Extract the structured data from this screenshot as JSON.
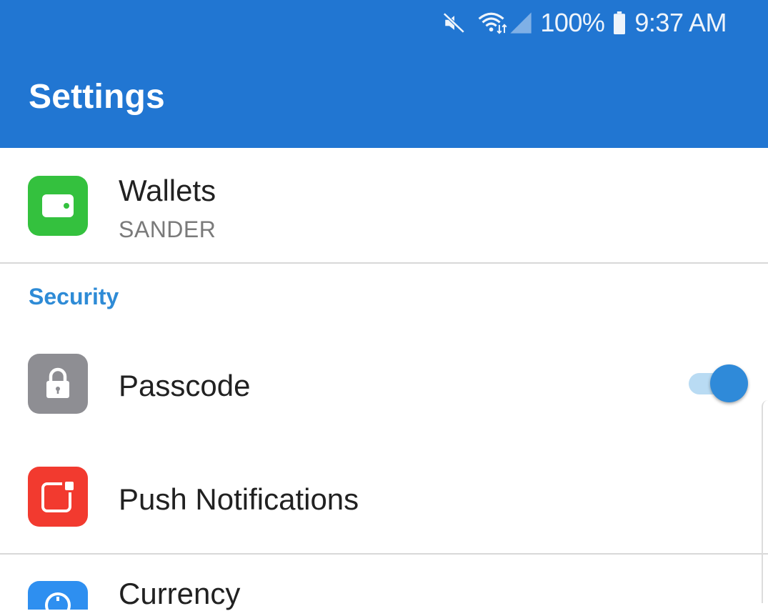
{
  "status_bar": {
    "battery_percent": "100%",
    "time": "9:37 AM",
    "icons": [
      "mute-icon",
      "wifi-icon",
      "signal-icon",
      "battery-icon"
    ]
  },
  "header": {
    "title": "Settings",
    "color": "#2176d2"
  },
  "wallets_row": {
    "label": "Wallets",
    "subtitle": "SANDER",
    "icon": "wallet-icon",
    "icon_color": "#34c13e"
  },
  "security_section": {
    "header": "Security",
    "items": [
      {
        "label": "Passcode",
        "icon": "lock-icon",
        "icon_color": "#8e8e93",
        "toggle_on": true
      },
      {
        "label": "Push Notifications",
        "icon": "notification-icon",
        "icon_color": "#f23a2f"
      }
    ]
  },
  "currency_row": {
    "label": "Currency",
    "icon": "currency-icon",
    "icon_color": "#2e8ff0"
  },
  "colors": {
    "accent": "#2e8bd6",
    "toggle_thumb": "#2f8ad9",
    "toggle_track": "#b9dbf3"
  }
}
